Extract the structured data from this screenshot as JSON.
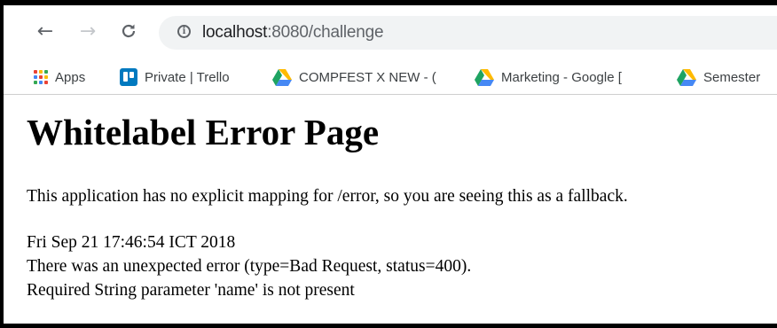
{
  "browser": {
    "url_host": "localhost",
    "url_path": ":8080/challenge",
    "bookmarks": [
      {
        "label": "Apps",
        "icon": "apps-grid-icon"
      },
      {
        "label": "Private | Trello",
        "icon": "trello-icon"
      },
      {
        "label": "COMPFEST X NEW - (",
        "icon": "google-drive-icon"
      },
      {
        "label": "Marketing - Google [",
        "icon": "google-drive-icon"
      },
      {
        "label": "Semester",
        "icon": "google-drive-icon"
      }
    ]
  },
  "page": {
    "title": "Whitelabel Error Page",
    "message": "This application has no explicit mapping for /error, so you are seeing this as a fallback.",
    "timestamp": "Fri Sep 21 17:46:54 ICT 2018",
    "error_line": "There was an unexpected error (type=Bad Request, status=400).",
    "detail": "Required String parameter 'name' is not present"
  },
  "colors": {
    "drive_green": "#1ea362",
    "drive_yellow": "#ffba00",
    "drive_blue": "#4688f4",
    "trello_blue": "#0079bf"
  }
}
